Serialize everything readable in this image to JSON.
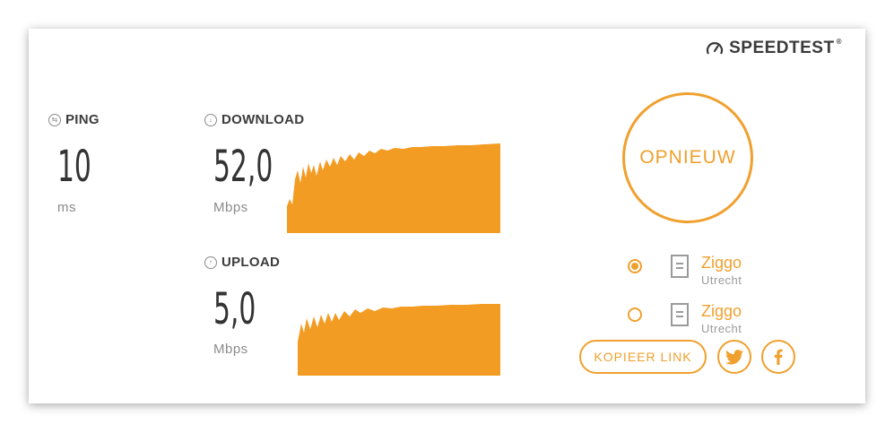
{
  "brand": {
    "name": "SPEEDTEST",
    "tm": "®"
  },
  "ping": {
    "label": "PING",
    "value": "10",
    "unit": "ms"
  },
  "download": {
    "label": "DOWNLOAD",
    "value": "52,0",
    "unit": "Mbps"
  },
  "upload": {
    "label": "UPLOAD",
    "value": "5,0",
    "unit": "Mbps"
  },
  "restart_label": "OPNIEUW",
  "servers": [
    {
      "name": "Ziggo",
      "location": "Utrecht",
      "selected": true
    },
    {
      "name": "Ziggo",
      "location": "Utrecht",
      "selected": false
    }
  ],
  "copy_link_label": "KOPIEER LINK",
  "icons": {
    "brand": "speedometer-icon",
    "ping": "ping-icon",
    "download": "download-arrow-icon",
    "upload": "upload-arrow-icon",
    "server": "server-document-icon",
    "twitter": "twitter-icon",
    "facebook": "facebook-icon"
  },
  "colors": {
    "accent": "#f0a02e",
    "graph": "#f39c24",
    "text": "#333333",
    "muted": "#8a8a8a"
  }
}
